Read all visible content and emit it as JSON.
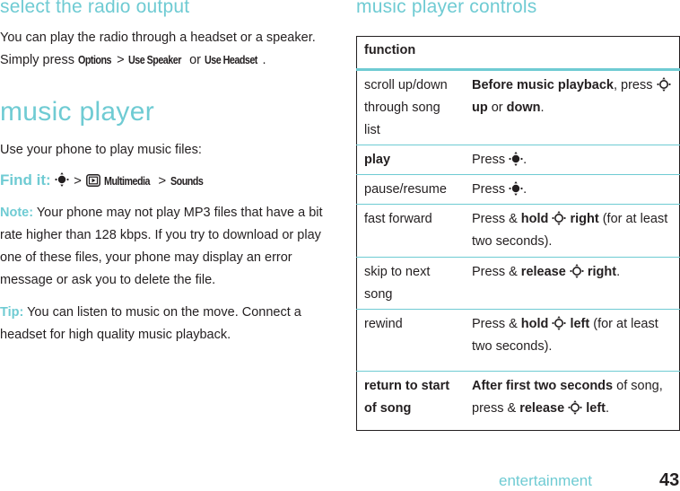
{
  "left": {
    "section_title": "select the radio output",
    "radio_text_1": "You can play the radio through a headset or a speaker. Simply press",
    "radio_kw_options": "Options",
    "radio_gt": ">",
    "radio_kw_speaker": "Use Speaker",
    "radio_or": "or",
    "radio_kw_headset": "Use Headset",
    "radio_end": ".",
    "player_title": "music player",
    "player_intro": "Use your phone to play music files:",
    "find_it": {
      "label": "Find it:",
      "nav_icon": "nav-key-center-icon",
      "sep1": ">",
      "menu_icon": "multimedia-icon",
      "item1": "Multimedia",
      "sep2": ">",
      "item2": "Sounds"
    },
    "note": {
      "label": "Note:",
      "text": "Your phone may not play MP3 files that have a bit rate higher than 128 kbps. If you try to download or play one of these files, your phone may display an error message or ask you to delete the file."
    },
    "tip": {
      "label": "Tip:",
      "text": "You can listen to music on the move. Connect a headset for high quality music playback."
    }
  },
  "right": {
    "section_title": "music player controls",
    "table_header": "function",
    "rows": [
      {
        "function": "scroll up/down through song list",
        "fn_bold": false,
        "desc": [
          {
            "t": "Before music playback",
            "b": true
          },
          {
            "t": ", press ",
            "b": false
          },
          {
            "icon": "nav-key-direction-icon"
          },
          {
            "t": "up",
            "b": true
          },
          {
            "t": " or ",
            "b": false
          },
          {
            "t": "down",
            "b": true
          },
          {
            "t": ".",
            "b": false
          }
        ]
      },
      {
        "function": "play",
        "fn_bold": true,
        "desc": [
          {
            "t": "Press ",
            "b": false
          },
          {
            "icon": "nav-key-center-icon"
          },
          {
            "t": ".",
            "b": false
          }
        ]
      },
      {
        "function": "pause/resume",
        "fn_bold": false,
        "desc": [
          {
            "t": "Press ",
            "b": false
          },
          {
            "icon": "nav-key-center-icon"
          },
          {
            "t": ".",
            "b": false
          }
        ]
      },
      {
        "function": "fast forward",
        "fn_bold": false,
        "desc": [
          {
            "t": "Press & ",
            "b": false
          },
          {
            "t": "hold ",
            "b": true
          },
          {
            "icon": "nav-key-direction-icon"
          },
          {
            "t": " right",
            "b": true
          },
          {
            "t": " (for at least two seconds).",
            "b": false
          }
        ]
      },
      {
        "function": "skip to next song",
        "fn_bold": false,
        "desc": [
          {
            "t": "Press & ",
            "b": false
          },
          {
            "t": "release ",
            "b": true
          },
          {
            "icon": "nav-key-direction-icon"
          },
          {
            "t": " right",
            "b": true
          },
          {
            "t": ".",
            "b": false
          }
        ]
      },
      {
        "function": "rewind",
        "fn_bold": false,
        "desc": [
          {
            "t": "Press & ",
            "b": false
          },
          {
            "t": "hold ",
            "b": true
          },
          {
            "icon": "nav-key-direction-icon"
          },
          {
            "t": " left",
            "b": true
          },
          {
            "t": " (for at least two seconds).",
            "b": false
          }
        ]
      },
      {
        "function": "return to start of song",
        "fn_bold": true,
        "desc": [
          {
            "t": "After first two seconds",
            "b": true
          },
          {
            "t": " of song, press & ",
            "b": false
          },
          {
            "t": "release ",
            "b": true
          },
          {
            "icon": "nav-key-direction-icon"
          },
          {
            "t": " left",
            "b": true
          },
          {
            "t": ".",
            "b": false
          }
        ]
      }
    ]
  },
  "footer": {
    "section": "entertainment",
    "page_number": "43"
  },
  "colors": {
    "accent": "#6fcbd3",
    "text": "#231f20"
  }
}
